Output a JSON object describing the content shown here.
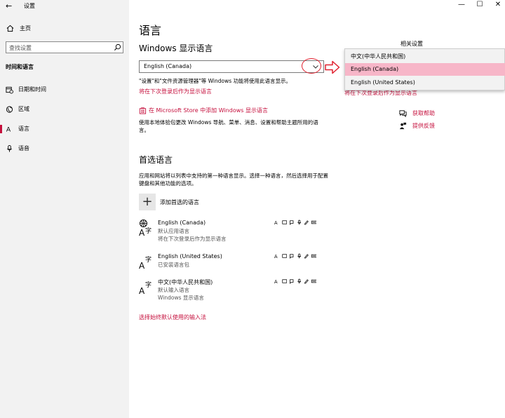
{
  "window": {
    "title": "设置",
    "back_glyph": "←",
    "controls": {
      "minimize": "—",
      "maximize": "☐",
      "close": "✕"
    }
  },
  "sidebar": {
    "home_label": "主页",
    "search_placeholder": "查找设置",
    "section_heading": "时间和语言",
    "items": [
      {
        "label": "日期和时间",
        "icon": "calendar-clock-icon",
        "selected": false
      },
      {
        "label": "区域",
        "icon": "globe-icon",
        "selected": false
      },
      {
        "label": "语言",
        "icon": "language-icon",
        "selected": true
      },
      {
        "label": "语音",
        "icon": "microphone-icon",
        "selected": false
      }
    ]
  },
  "main": {
    "title": "语言",
    "display_language": {
      "heading": "Windows 显示语言",
      "selected_value": "English (Canada)",
      "note": "\"设置\"和\"文件资源管理器\"等 Windows 功能将使用此语言显示。",
      "pending_note": "将在下次登录后作为显示语言"
    },
    "store": {
      "link": "在 Microsoft Store 中添加 Windows 显示语言",
      "description": "使用本地体验包更改 Windows 导航、菜单、消息、设置和帮助主题所用的语言。"
    },
    "preferred": {
      "heading": "首选语言",
      "description": "应用和网站将以列表中支持的第一种语言显示。选择一种语言，然后选择用于配置键盘和其他功能的选项。",
      "add_label": "添加首选的语言",
      "languages": [
        {
          "name": "English (Canada)",
          "lines": [
            "默认应用语言",
            "将在下次登录后作为显示语言"
          ]
        },
        {
          "name": "English (United States)",
          "lines": [
            "已安装语言包"
          ]
        },
        {
          "name": "中文(中华人民共和国)",
          "lines": [
            "默认输入语言",
            "Windows 显示语言"
          ]
        }
      ]
    },
    "input_method_link": "选择始终默认使用的输入法"
  },
  "right": {
    "related_heading": "相关设置",
    "partial_link": "将在下次登录后作为显示语言",
    "help": {
      "label": "获取帮助",
      "icon": "chat-help-icon"
    },
    "feedback": {
      "label": "提供反馈",
      "icon": "feedback-person-icon"
    }
  },
  "dropdown_options": [
    {
      "label": "中文(中华人民共和国)",
      "selected": false
    },
    {
      "label": "English (Canada)",
      "selected": true
    },
    {
      "label": "English (United States)",
      "selected": false
    }
  ],
  "colors": {
    "accent": "#c50f3c",
    "sidebar_bg": "#f2f2f2",
    "selected_option_bg": "#f7b6c8",
    "annotation": "#e0202e"
  }
}
